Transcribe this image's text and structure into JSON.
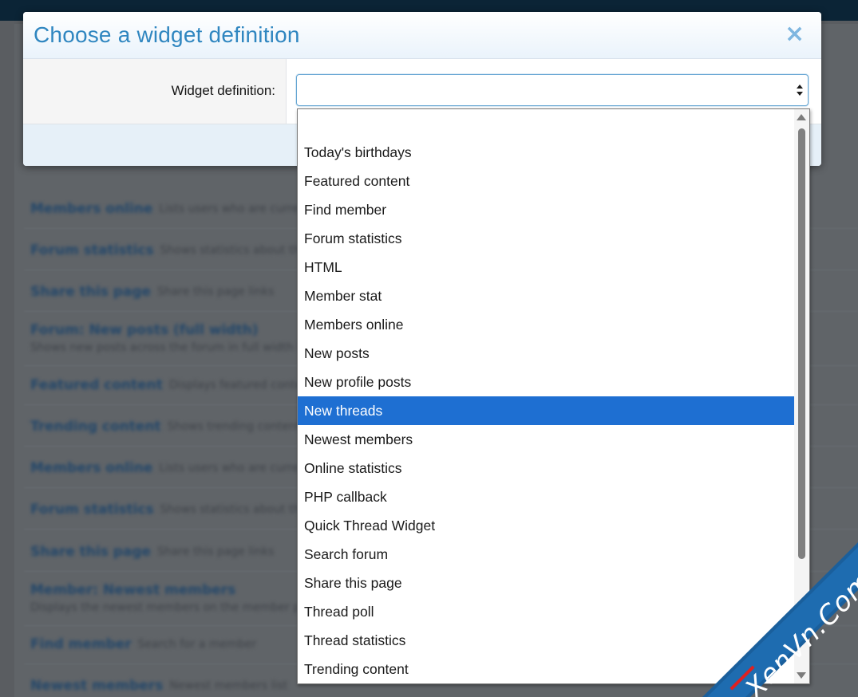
{
  "dialog": {
    "title": "Choose a widget definition",
    "close_symbol": "×",
    "field_label": "Widget definition:",
    "select_value": ""
  },
  "dropdown": {
    "options": [
      "",
      "Today's birthdays",
      "Featured content",
      "Find member",
      "Forum statistics",
      "HTML",
      "Member stat",
      "Members online",
      "New posts",
      "New profile posts",
      "New threads",
      "Newest members",
      "Online statistics",
      "PHP callback",
      "Quick Thread Widget",
      "Search forum",
      "Share this page",
      "Thread poll",
      "Thread statistics",
      "Trending content"
    ],
    "selected": "New threads"
  },
  "background_rows": [
    {
      "title": "Members online",
      "desc": "Lists users who are currently online"
    },
    {
      "title": "Forum statistics",
      "desc": "Shows statistics about the forum"
    },
    {
      "title": "Share this page",
      "desc": "Share this page links"
    },
    {
      "title": "Forum: New posts (full width)",
      "desc": "Shows new posts across the forum in full width layout"
    },
    {
      "title": "Featured content",
      "desc": "Displays featured content"
    },
    {
      "title": "Trending content",
      "desc": "Shows trending content"
    },
    {
      "title": "Members online",
      "desc": "Lists users who are currently online"
    },
    {
      "title": "Forum statistics",
      "desc": "Shows statistics about the forum"
    },
    {
      "title": "Share this page",
      "desc": "Share this page links"
    },
    {
      "title": "Member: Newest members",
      "desc": "Displays the newest members on the member page"
    },
    {
      "title": "Find member",
      "desc": "Search for a member"
    },
    {
      "title": "Newest members",
      "desc": "Newest members list"
    }
  ],
  "icons": {
    "close": "close-icon",
    "select_arrows": "select-arrows-icon",
    "scroll_up": "scroll-up-arrow-icon",
    "scroll_down": "scroll-down-arrow-icon"
  },
  "watermark": {
    "text": "XenVn.Com"
  },
  "colors": {
    "accent": "#2f86c0",
    "selected_option": "#1e6fd2",
    "watermark_bg": "#1a5f9c"
  }
}
